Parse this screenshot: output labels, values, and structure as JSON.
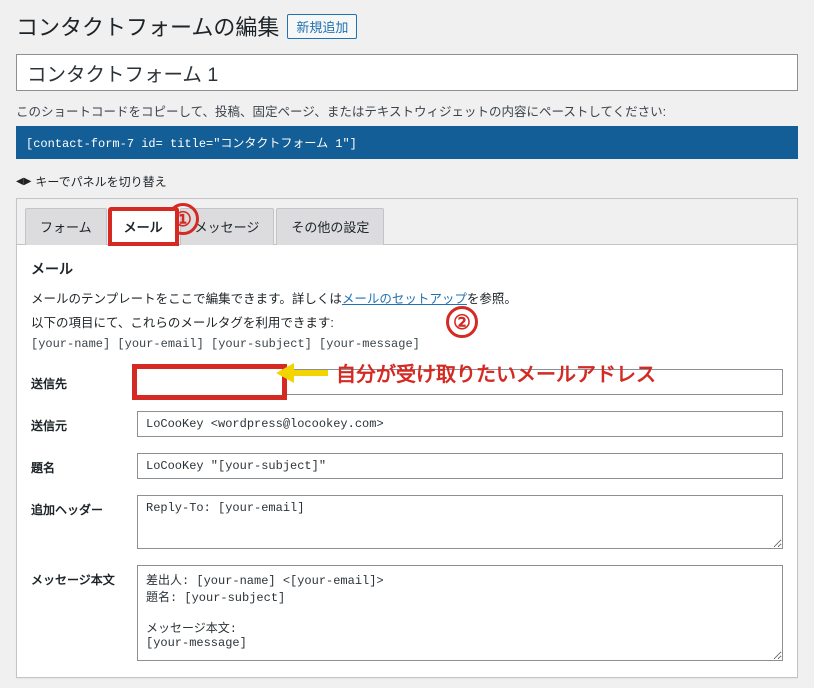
{
  "header": {
    "title": "コンタクトフォームの編集",
    "add_new": "新規追加"
  },
  "form_title": "コンタクトフォーム 1",
  "shortcode_hint": "このショートコードをコピーして、投稿、固定ページ、またはテキストウィジェットの内容にペーストしてください:",
  "shortcode": "[contact-form-7 id=      title=\"コンタクトフォーム 1\"]",
  "toggle_hint": "キーでパネルを切り替え",
  "tabs": [
    {
      "label": "フォーム"
    },
    {
      "label": "メール"
    },
    {
      "label": "メッセージ"
    },
    {
      "label": "その他の設定"
    }
  ],
  "panel": {
    "heading": "メール",
    "desc_before": "メールのテンプレートをここで編集できます。詳しくは",
    "desc_link": "メールのセットアップ",
    "desc_after": "を参照。",
    "tags_intro": "以下の項目にて、これらのメールタグを利用できます:",
    "tags": "[your-name] [your-email] [your-subject] [your-message]"
  },
  "fields": {
    "to": {
      "label": "送信先",
      "value": ""
    },
    "from": {
      "label": "送信元",
      "value": "LoCooKey <wordpress@locookey.com>"
    },
    "subject": {
      "label": "題名",
      "value": "LoCooKey \"[your-subject]\""
    },
    "headers": {
      "label": "追加ヘッダー",
      "value": "Reply-To: [your-email]"
    },
    "body": {
      "label": "メッセージ本文",
      "value": "差出人: [your-name] <[your-email]>\n題名: [your-subject]\n\nメッセージ本文:\n[your-message]"
    }
  },
  "annotations": {
    "c1": "①",
    "c2": "②",
    "arrow_text": "自分が受け取りたいメールアドレス"
  }
}
